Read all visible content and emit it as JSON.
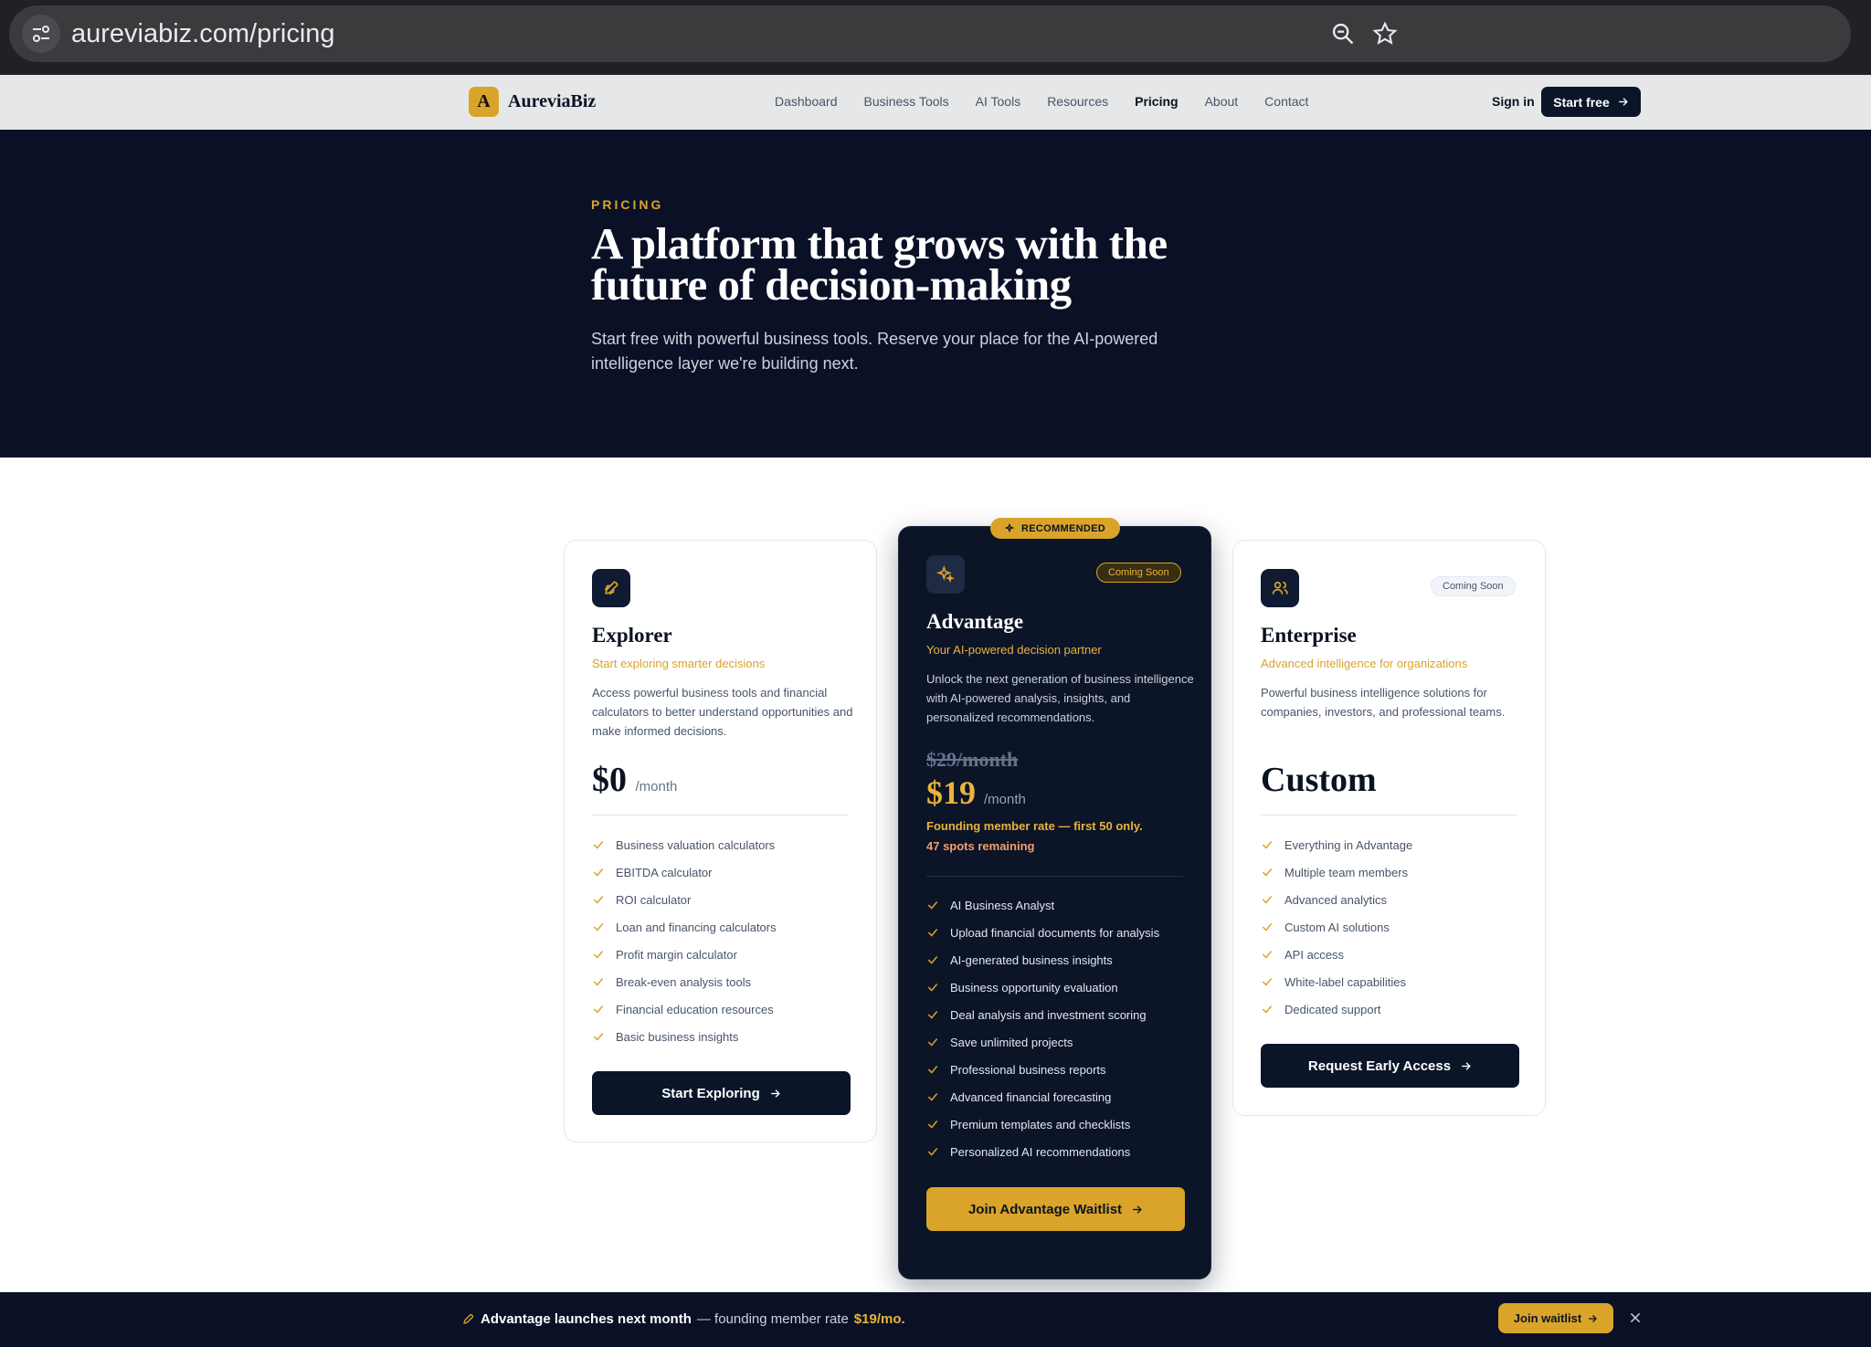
{
  "browser": {
    "url": "aureviabiz.com/pricing"
  },
  "nav": {
    "brand_mark": "A",
    "brand_name": "AureviaBiz",
    "links": [
      "Dashboard",
      "Business Tools",
      "AI Tools",
      "Resources",
      "Pricing",
      "About",
      "Contact"
    ],
    "active": "Pricing",
    "signin": "Sign in",
    "start_free": "Start free"
  },
  "hero": {
    "eyebrow": "PRICING",
    "title": "A platform that grows with the future of decision-making",
    "subtitle": "Start free with powerful business tools. Reserve your place for the AI-powered intelligence layer we're building next."
  },
  "recommended_badge": "RECOMMENDED",
  "plans": [
    {
      "name": "Explorer",
      "tagline": "Start exploring smarter decisions",
      "description": "Access powerful business tools and financial calculators to better understand opportunities and make informed decisions.",
      "price": "$0",
      "per": "/month",
      "features": [
        "Business valuation calculators",
        "EBITDA calculator",
        "ROI calculator",
        "Loan and financing calculators",
        "Profit margin calculator",
        "Break-even analysis tools",
        "Financial education resources",
        "Basic business insights"
      ],
      "cta": "Start Exploring"
    },
    {
      "name": "Advantage",
      "badge": "Coming Soon",
      "tagline": "Your AI-powered decision partner",
      "description": "Unlock the next generation of business intelligence with AI-powered analysis, insights, and personalized recommendations.",
      "old_price": "$29/month",
      "price": "$19",
      "per": "/month",
      "founding_note": "Founding member rate — first 50 only.",
      "spots": "47 spots remaining",
      "features": [
        "AI Business Analyst",
        "Upload financial documents for analysis",
        "AI-generated business insights",
        "Business opportunity evaluation",
        "Deal analysis and investment scoring",
        "Save unlimited projects",
        "Professional business reports",
        "Advanced financial forecasting",
        "Premium templates and checklists",
        "Personalized AI recommendations"
      ],
      "cta": "Join Advantage Waitlist"
    },
    {
      "name": "Enterprise",
      "badge": "Coming Soon",
      "tagline": "Advanced intelligence for organizations",
      "description": "Powerful business intelligence solutions for companies, investors, and professional teams.",
      "price": "Custom",
      "features": [
        "Everything in Advantage",
        "Multiple team members",
        "Advanced analytics",
        "Custom AI solutions",
        "API access",
        "White-label capabilities",
        "Dedicated support"
      ],
      "cta": "Request Early Access"
    }
  ],
  "banner": {
    "headline": "Advantage launches next month",
    "text": "— founding member rate",
    "rate": "$19/mo.",
    "button": "Join waitlist"
  },
  "colors": {
    "navy": "#0a1126",
    "gold": "#d9a429",
    "muted": "#475569"
  },
  "icons": [
    "sliders-icon",
    "zoom-icon",
    "star-icon",
    "rocket-icon",
    "sparkles-icon",
    "users-icon",
    "check-icon",
    "arrow-right-icon",
    "close-icon"
  ]
}
